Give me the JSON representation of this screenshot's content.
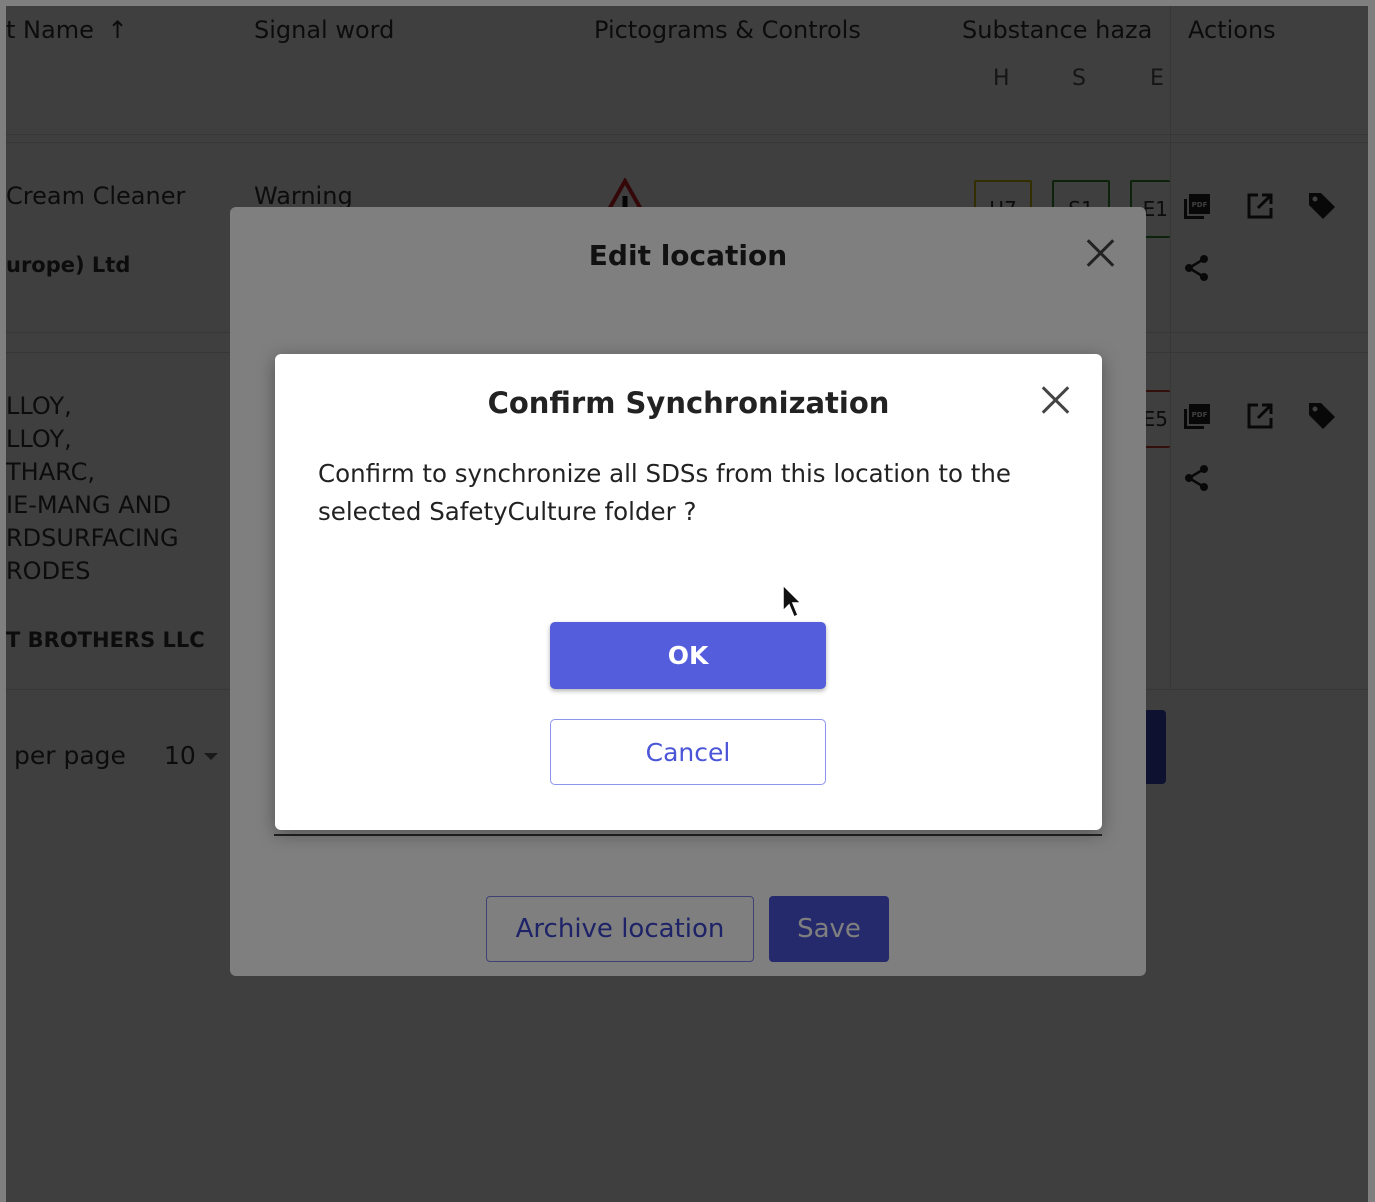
{
  "table": {
    "headers": {
      "name": "t Name",
      "name_sort_icon": "arrow-up-icon",
      "signal_word": "Signal word",
      "pictograms": "Pictograms & Controls",
      "substance_hazard": "Substance haza",
      "actions": "Actions"
    },
    "hazard_subheaders": [
      "H",
      "S",
      "E"
    ],
    "rows": [
      {
        "name": "Cream Cleaner",
        "supplier": "urope) Ltd",
        "signal_word": "Warning",
        "hazard_codes": [
          "H7",
          "S1",
          "E1"
        ],
        "hazard_colors": [
          "#c9b800",
          "#2c8a2c",
          "#2c8a2c"
        ]
      },
      {
        "name_lines": [
          "LLOY,",
          "LLOY,",
          "THARC,",
          "IE-MANG AND",
          "RDSURFACING",
          "RODES"
        ],
        "supplier": "T BROTHERS LLC",
        "signal_word": "",
        "hazard_codes": [
          "E5"
        ],
        "hazard_colors": [
          "#d23a2c"
        ]
      }
    ],
    "action_icons": [
      "pdf-icon",
      "open-external-icon",
      "tag-icon",
      "share-icon"
    ]
  },
  "pagination": {
    "label": "per page",
    "value": "10"
  },
  "edit_modal": {
    "title": "Edit location",
    "archive_label": "Archive location",
    "save_label": "Save"
  },
  "confirm_modal": {
    "title": "Confirm Synchronization",
    "message": "Confirm to synchronize all SDSs from this location to the selected SafetyCulture folder ?",
    "ok_label": "OK",
    "cancel_label": "Cancel"
  },
  "colors": {
    "primary": "#4a55d8",
    "overlay": "rgba(0,0,0,0.5)"
  }
}
